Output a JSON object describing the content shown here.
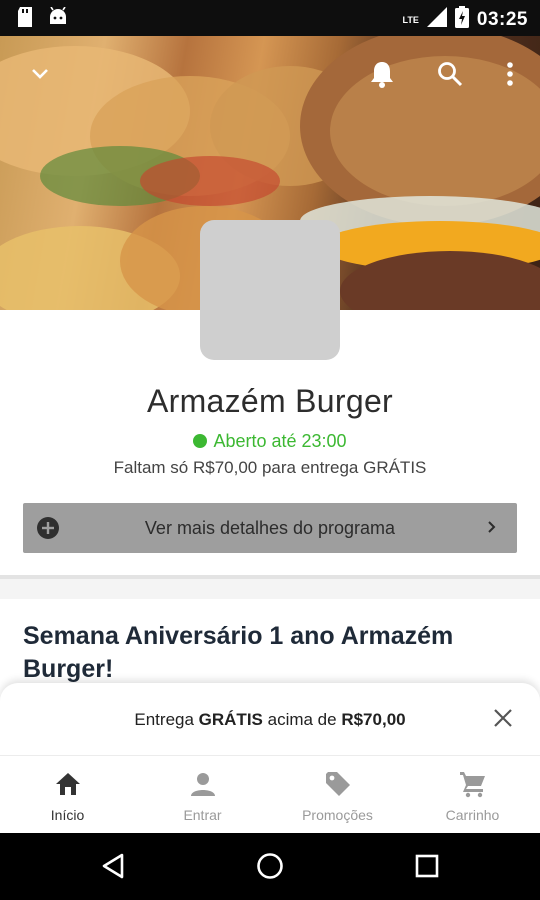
{
  "status_bar": {
    "time": "03:25",
    "network": "LTE",
    "icons": [
      "sd-card-icon",
      "android-icon",
      "signal-icon",
      "battery-icon"
    ]
  },
  "hero": {
    "icons": [
      "chevron-down-icon",
      "bell-icon",
      "search-icon",
      "more-vert-icon"
    ]
  },
  "store": {
    "name": "Armazém Burger",
    "open_status": "Aberto até 23:00",
    "delivery_message": "Faltam só R$70,00 para entrega GRÁTIS",
    "program_button_label": "Ver mais detalhes do programa"
  },
  "promo": {
    "title": "Semana Aniversário 1 ano Armazém Burger!"
  },
  "free_delivery_sheet": {
    "prefix": "Entrega ",
    "highlight": "GRÁTIS",
    "middle": " acima de ",
    "amount": "R$70,00"
  },
  "bottom_nav": {
    "items": [
      {
        "label": "Início",
        "icon": "home-icon",
        "active": true
      },
      {
        "label": "Entrar",
        "icon": "person-icon",
        "active": false
      },
      {
        "label": "Promoções",
        "icon": "tag-icon",
        "active": false
      },
      {
        "label": "Carrinho",
        "icon": "cart-icon",
        "active": false
      }
    ]
  },
  "colors": {
    "open_green": "#3cb832",
    "promo_title": "#1f2a38",
    "program_button_bg": "#9e9e9e"
  }
}
